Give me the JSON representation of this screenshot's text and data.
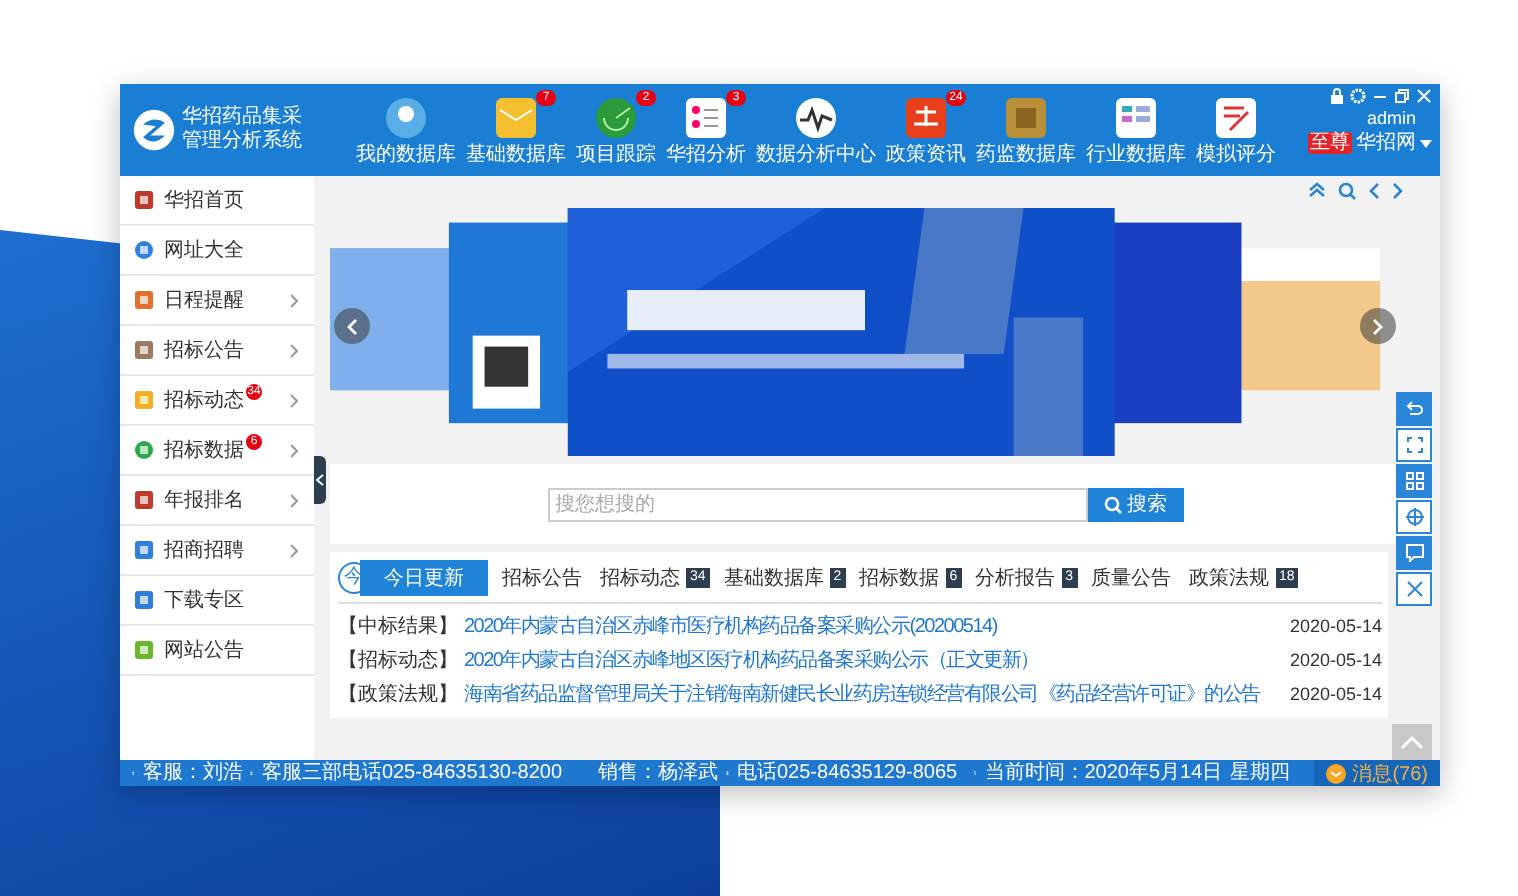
{
  "app": {
    "logo_line1": "华招药品集采",
    "logo_line2": "管理分析系统"
  },
  "nav": [
    {
      "label": "我的数据库"
    },
    {
      "label": "基础数据库",
      "badge": "7"
    },
    {
      "label": "项目跟踪",
      "badge": "2"
    },
    {
      "label": "华招分析",
      "badge": "3"
    },
    {
      "label": "数据分析中心"
    },
    {
      "label": "政策资讯",
      "badge": "24"
    },
    {
      "label": "药监数据库"
    },
    {
      "label": "行业数据库"
    },
    {
      "label": "模拟评分"
    }
  ],
  "user": {
    "name": "admin",
    "level": "至尊",
    "site": "华招网"
  },
  "sidebar": {
    "items": [
      {
        "label": "华招首页",
        "expandable": false
      },
      {
        "label": "网址大全",
        "expandable": false
      },
      {
        "label": "日程提醒",
        "expandable": true
      },
      {
        "label": "招标公告",
        "expandable": true
      },
      {
        "label": "招标动态",
        "badge": "34",
        "expandable": true
      },
      {
        "label": "招标数据",
        "badge": "6",
        "expandable": true
      },
      {
        "label": "年报排名",
        "expandable": true
      },
      {
        "label": "招商招聘",
        "expandable": true
      },
      {
        "label": "下载专区",
        "expandable": false
      },
      {
        "label": "网站公告",
        "expandable": false
      }
    ]
  },
  "search": {
    "placeholder": "搜您想搜的",
    "button": "搜索"
  },
  "updates": {
    "badge_char": "今",
    "tabs": [
      {
        "label": "今日更新",
        "selected": true
      },
      {
        "label": "招标公告",
        "selected": false
      },
      {
        "label": "招标动态",
        "count": "34",
        "selected": false
      },
      {
        "label": "基础数据库",
        "count": "2",
        "selected": false
      },
      {
        "label": "招标数据",
        "count": "6",
        "selected": false
      },
      {
        "label": "分析报告",
        "count": "3",
        "selected": false
      },
      {
        "label": "质量公告",
        "selected": false
      },
      {
        "label": "政策法规",
        "count": "18",
        "selected": false
      }
    ],
    "rows": [
      {
        "category": "【中标结果】",
        "title": "2020年内蒙古自治区赤峰市医疗机构药品备案采购公示(20200514)",
        "date": "2020-05-14"
      },
      {
        "category": "【招标动态】",
        "title": "2020年内蒙古自治区赤峰地区医疗机构药品备案采购公示（正文更新）",
        "date": "2020-05-14"
      },
      {
        "category": "【政策法规】",
        "title": "海南省药品监督管理局关于注销海南新健民长业药房连锁经营有限公司《药品经营许可证》的公告",
        "date": "2020-05-14"
      }
    ]
  },
  "status_bar": {
    "service": "客服：刘浩",
    "service_phone": "客服三部电话025-84635130-8200",
    "sales": "销售：杨泽武",
    "sales_phone": "电话025-84635129-8065",
    "time": "当前时间：2020年5月14日",
    "weekday": "星期四",
    "messages": "消息(76)"
  }
}
